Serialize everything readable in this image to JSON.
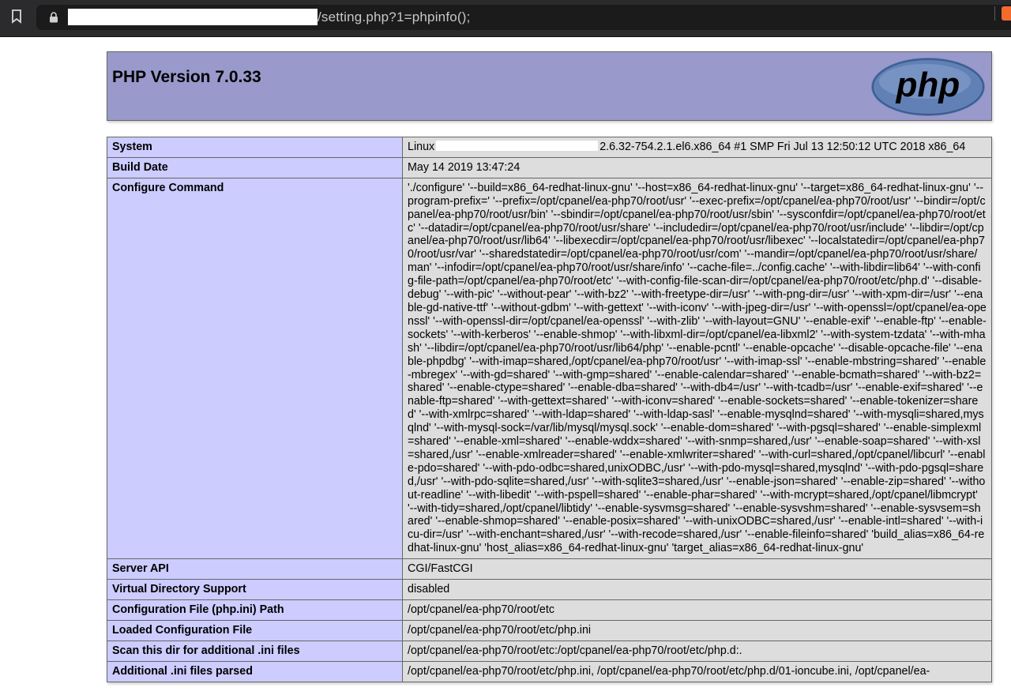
{
  "browser": {
    "url_visible": "/setting.php?1=phpinfo();"
  },
  "header": {
    "title": "PHP Version 7.0.33",
    "logo_text": "php"
  },
  "rows": [
    {
      "label": "System",
      "value_prefix": "Linux",
      "value_suffix": "2.6.32-754.2.1.el6.x86_64 #1 SMP Fri Jul 13 12:50:12 UTC 2018 x86_64"
    },
    {
      "label": "Build Date",
      "value": "May 14 2019 13:47:24"
    },
    {
      "label": "Configure Command",
      "value": "'./configure' '--build=x86_64-redhat-linux-gnu' '--host=x86_64-redhat-linux-gnu' '--target=x86_64-redhat-linux-gnu' '--program-prefix=' '--prefix=/opt/cpanel/ea-php70/root/usr' '--exec-prefix=/opt/cpanel/ea-php70/root/usr' '--bindir=/opt/cpanel/ea-php70/root/usr/bin' '--sbindir=/opt/cpanel/ea-php70/root/usr/sbin' '--sysconfdir=/opt/cpanel/ea-php70/root/etc' '--datadir=/opt/cpanel/ea-php70/root/usr/share' '--includedir=/opt/cpanel/ea-php70/root/usr/include' '--libdir=/opt/cpanel/ea-php70/root/usr/lib64' '--libexecdir=/opt/cpanel/ea-php70/root/usr/libexec' '--localstatedir=/opt/cpanel/ea-php70/root/usr/var' '--sharedstatedir=/opt/cpanel/ea-php70/root/usr/com' '--mandir=/opt/cpanel/ea-php70/root/usr/share/man' '--infodir=/opt/cpanel/ea-php70/root/usr/share/info' '--cache-file=../config.cache' '--with-libdir=lib64' '--with-config-file-path=/opt/cpanel/ea-php70/root/etc' '--with-config-file-scan-dir=/opt/cpanel/ea-php70/root/etc/php.d' '--disable-debug' '--with-pic' '--without-pear' '--with-bz2' '--with-freetype-dir=/usr' '--with-png-dir=/usr' '--with-xpm-dir=/usr' '--enable-gd-native-ttf' '--without-gdbm' '--with-gettext' '--with-iconv' '--with-jpeg-dir=/usr' '--with-openssl=/opt/cpanel/ea-openssl' '--with-openssl-dir=/opt/cpanel/ea-openssl' '--with-zlib' '--with-layout=GNU' '--enable-exif' '--enable-ftp' '--enable-sockets' '--with-kerberos' '--enable-shmop' '--with-libxml-dir=/opt/cpanel/ea-libxml2' '--with-system-tzdata' '--with-mhash' '--libdir=/opt/cpanel/ea-php70/root/usr/lib64/php' '--enable-pcntl' '--enable-opcache' '--disable-opcache-file' '--enable-phpdbg' '--with-imap=shared,/opt/cpanel/ea-php70/root/usr' '--with-imap-ssl' '--enable-mbstring=shared' '--enable-mbregex' '--with-gd=shared' '--with-gmp=shared' '--enable-calendar=shared' '--enable-bcmath=shared' '--with-bz2=shared' '--enable-ctype=shared' '--enable-dba=shared' '--with-db4=/usr' '--with-tcadb=/usr' '--enable-exif=shared' '--enable-ftp=shared' '--with-gettext=shared' '--with-iconv=shared' '--enable-sockets=shared' '--enable-tokenizer=shared' '--with-xmlrpc=shared' '--with-ldap=shared' '--with-ldap-sasl' '--enable-mysqlnd=shared' '--with-mysqli=shared,mysqlnd' '--with-mysql-sock=/var/lib/mysql/mysql.sock' '--enable-dom=shared' '--with-pgsql=shared' '--enable-simplexml=shared' '--enable-xml=shared' '--enable-wddx=shared' '--with-snmp=shared,/usr' '--enable-soap=shared' '--with-xsl=shared,/usr' '--enable-xmlreader=shared' '--enable-xmlwriter=shared' '--with-curl=shared,/opt/cpanel/libcurl' '--enable-pdo=shared' '--with-pdo-odbc=shared,unixODBC,/usr' '--with-pdo-mysql=shared,mysqlnd' '--with-pdo-pgsql=shared,/usr' '--with-pdo-sqlite=shared,/usr' '--with-sqlite3=shared,/usr' '--enable-json=shared' '--enable-zip=shared' '--without-readline' '--with-libedit' '--with-pspell=shared' '--enable-phar=shared' '--with-mcrypt=shared,/opt/cpanel/libmcrypt' '--with-tidy=shared,/opt/cpanel/libtidy' '--enable-sysvmsg=shared' '--enable-sysvshm=shared' '--enable-sysvsem=shared' '--enable-shmop=shared' '--enable-posix=shared' '--with-unixODBC=shared,/usr' '--enable-intl=shared' '--with-icu-dir=/usr' '--with-enchant=shared,/usr' '--with-recode=shared,/usr' '--enable-fileinfo=shared' 'build_alias=x86_64-redhat-linux-gnu' 'host_alias=x86_64-redhat-linux-gnu' 'target_alias=x86_64-redhat-linux-gnu'"
    },
    {
      "label": "Server API",
      "value": "CGI/FastCGI"
    },
    {
      "label": "Virtual Directory Support",
      "value": "disabled"
    },
    {
      "label": "Configuration File (php.ini) Path",
      "value": "/opt/cpanel/ea-php70/root/etc"
    },
    {
      "label": "Loaded Configuration File",
      "value": "/opt/cpanel/ea-php70/root/etc/php.ini"
    },
    {
      "label": "Scan this dir for additional .ini files",
      "value": "/opt/cpanel/ea-php70/root/etc:/opt/cpanel/ea-php70/root/etc/php.d:."
    },
    {
      "label": "Additional .ini files parsed",
      "value": "/opt/cpanel/ea-php70/root/etc/php.ini, /opt/cpanel/ea-php70/root/etc/php.d/01-ioncube.ini, /opt/cpanel/ea-"
    }
  ]
}
